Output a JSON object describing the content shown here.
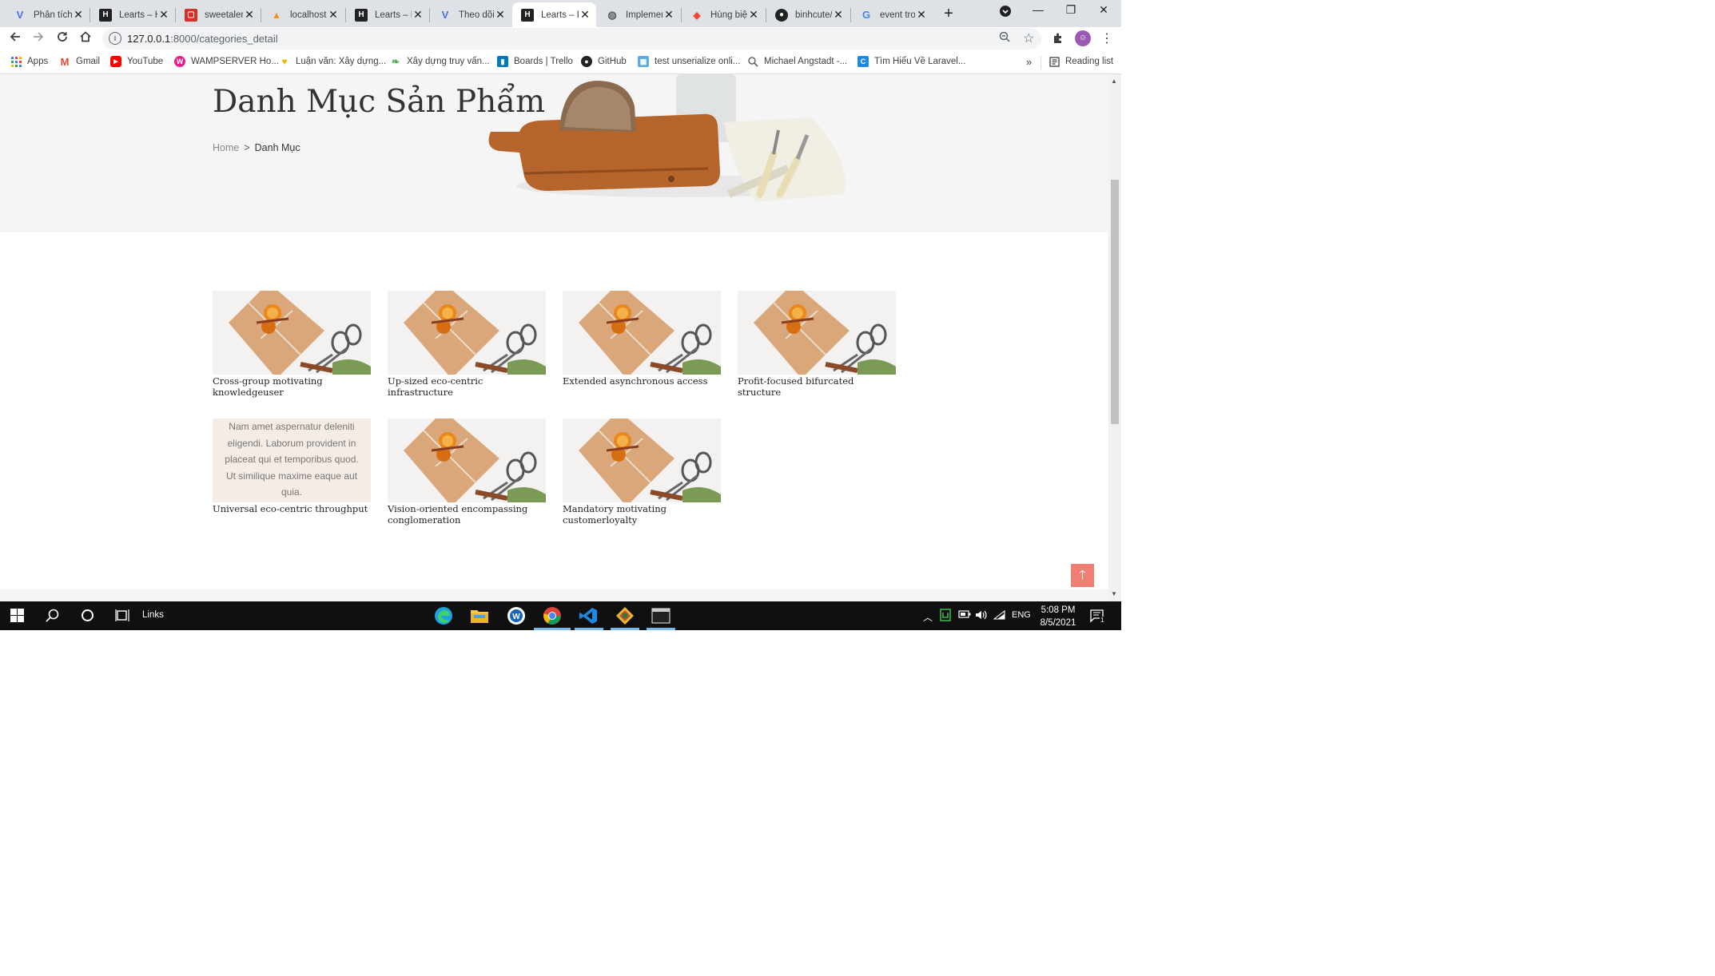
{
  "browser": {
    "tabs": [
      {
        "title": "Phân tích",
        "favicon": "v-logo",
        "left": 0
      },
      {
        "title": "Learts – H",
        "favicon": "learts-logo"
      },
      {
        "title": "sweetaler",
        "favicon": "sweetalert-logo"
      },
      {
        "title": "localhost",
        "favicon": "pma-logo"
      },
      {
        "title": "Learts – H",
        "favicon": "learts-logo"
      },
      {
        "title": "Theo dõi",
        "favicon": "v-logo"
      },
      {
        "title": "Learts – D",
        "favicon": "learts-logo"
      },
      {
        "title": "Implemen",
        "favicon": "globe-icon"
      },
      {
        "title": "Hùng biệ",
        "favicon": "laravel-logo"
      },
      {
        "title": "binhcute/",
        "favicon": "github-icon"
      },
      {
        "title": "event tro",
        "favicon": "google-logo"
      }
    ],
    "url_host": "127.0.0.1",
    "url_path": ":8000/categories_detail",
    "bookmarks": [
      "Apps",
      "Gmail",
      "YouTube",
      "WAMPSERVER Ho...",
      "Luận văn: Xây dựng...",
      "Xây dựng truy vấn...",
      "Boards | Trello",
      "GitHub",
      "test unserialize onli...",
      "Michael Angstadt -...",
      "Tìm Hiểu Về Laravel..."
    ],
    "bookmarks_more": "»",
    "reading_list": "Reading list"
  },
  "hero": {
    "title": "Danh Mục Sản Phẩm",
    "breadcrumb_home": "Home",
    "breadcrumb_sep": ">",
    "breadcrumb_current": "Danh Mục"
  },
  "categories": [
    {
      "name": "Cross-group motivating knowledgeuser"
    },
    {
      "name": "Up-sized eco-centric infrastructure"
    },
    {
      "name": "Extended asynchronous access"
    },
    {
      "name": "Profit-focused bifurcated structure"
    },
    {
      "name": "Universal eco-centric throughput",
      "description": "Nam amet aspernatur deleniti eligendi. Laborum provident in placeat qui et temporibus quod. Ut similique maxime eaque aut quia."
    },
    {
      "name": "Vision-oriented encompassing conglomeration"
    },
    {
      "name": "Mandatory motivating customerloyalty"
    }
  ],
  "scroll_top_icon": "arrow-up-icon",
  "taskbar": {
    "search_label": "Links",
    "language": "ENG",
    "time": "5:08 PM",
    "date": "8/5/2021",
    "notification_count": "1"
  }
}
